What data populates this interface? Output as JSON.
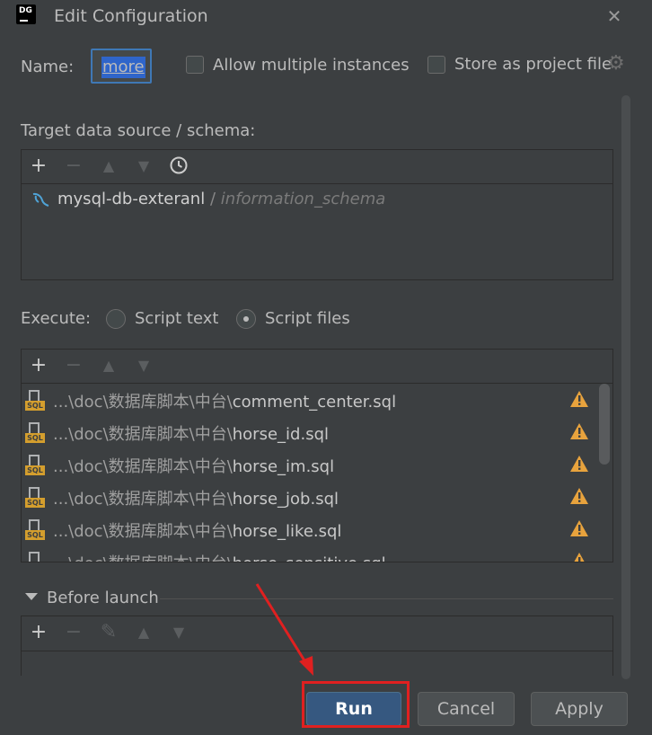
{
  "window": {
    "logo_text": "DG",
    "title": "Edit Configuration",
    "close_icon": "close-icon"
  },
  "name_field": {
    "label": "Name:",
    "value": "more"
  },
  "options": {
    "allow_multiple": "Allow multiple instances",
    "store_project": "Store as project file"
  },
  "target": {
    "label": "Target data source / schema:",
    "datasource": "mysql-db-exteranl",
    "separator": "/",
    "schema": "information_schema"
  },
  "execute": {
    "label": "Execute:",
    "option_text": "Script text",
    "option_files": "Script files",
    "selected": "Script files"
  },
  "files": [
    {
      "prefix": "...\\doc\\数据库脚本\\中台\\",
      "name": "comment_center.sql"
    },
    {
      "prefix": "...\\doc\\数据库脚本\\中台\\",
      "name": "horse_id.sql"
    },
    {
      "prefix": "...\\doc\\数据库脚本\\中台\\",
      "name": "horse_im.sql"
    },
    {
      "prefix": "...\\doc\\数据库脚本\\中台\\",
      "name": "horse_job.sql"
    },
    {
      "prefix": "...\\doc\\数据库脚本\\中台\\",
      "name": "horse_like.sql"
    },
    {
      "prefix": "...\\doc\\数据库脚本\\中台\\",
      "name": "horse_sensitive.sql"
    }
  ],
  "sql_badge": "SQL",
  "before_launch": {
    "label": "Before launch"
  },
  "buttons": {
    "run": "Run",
    "cancel": "Cancel",
    "apply": "Apply"
  },
  "toolbar_glyphs": {
    "add": "+",
    "remove": "−",
    "up": "▲",
    "down": "▼",
    "edit": "✎"
  },
  "colors": {
    "background": "#3c3f41",
    "accent": "#365880",
    "selection": "#2f65ca",
    "warning": "#d49e2d",
    "annotation": "#e02020"
  }
}
